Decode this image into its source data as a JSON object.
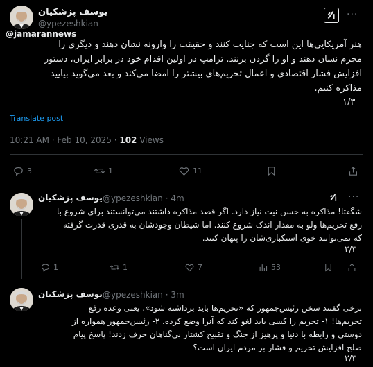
{
  "watermark": "@jamarannews",
  "main_tweet": {
    "author_name": "یوسف پزشکیان",
    "handle": "@ypezeshkian",
    "text_lines": [
      "هنر آمریکایی‌ها این است که جنایت کنند و حقیقت  را وارونه نشان دهند و دیگری را",
      "مجرم نشان دهند و او را گردن بزنند. ترامپ در اولین اقدام خود در برابر ایران، دستور",
      "افزایش فشار اقتصادی و اعمال تحریم‌های بیشتر را امضا می‌کند و بعد می‌گوید بیایید",
      "مذاکره کنیم."
    ],
    "counter": "۱/۳",
    "translate_label": "Translate post",
    "time": "10:21 AM · Feb 10, 2025 · ",
    "views_count": "102",
    "views_label": " Views",
    "actions": {
      "replies": "3",
      "reposts": "1",
      "likes": "11",
      "bookmarks": ""
    }
  },
  "reply_1": {
    "author_name": "یوسف پزشکیان",
    "handle": "@ypezeshkian · 4m",
    "text_lines": [
      "شگفتا! مذاکره به حسن نیت نیاز دارد. اگر قصد مذاکره داشتند می‌توانستند برای شروع با",
      "رفع تحریم‌ها ولو به مقدار اندک شروع کنند. اما شیطان وجودشان به قدری قدرت گرفته",
      "که نمی‌توانند خوی استکباری‌شان را پنهان کنند."
    ],
    "counter": "۲/۳",
    "actions": {
      "replies": "1",
      "reposts": "1",
      "likes": "7",
      "views": "53"
    }
  },
  "reply_2": {
    "author_name": "یوسف پزشکیان",
    "handle": "@ypezeshkian · 3m",
    "text_lines": [
      "برخی گفتند سخن رئیس‌جمهور که «تحریم‌ها باید برداشته شود»، یعنی وعده رفع",
      "تحریم‌ها! ۱- تحریم را کسی باید لغو کند که آنرا وضع کرده. ۲- رئیس‌جمهور همواره از",
      "دوستی و رابطه با دنیا و پرهیز از جنگ و تقبیح کشتار بی‌گناهان حرف زدند! پاسخ پیام",
      "صلح افزایش تحریم و فشار بر مردم ایران است؟"
    ],
    "counter": "۳/۳"
  },
  "colors": {
    "background": "#000000",
    "text": "#e7e9ea",
    "muted": "#71767b",
    "link": "#1d9bf0",
    "divider": "#2f3336"
  },
  "icons": [
    "avatar",
    "grok-icon",
    "more-icon",
    "reply-icon",
    "repost-icon",
    "like-icon",
    "bookmark-icon",
    "share-icon",
    "views-icon"
  ]
}
